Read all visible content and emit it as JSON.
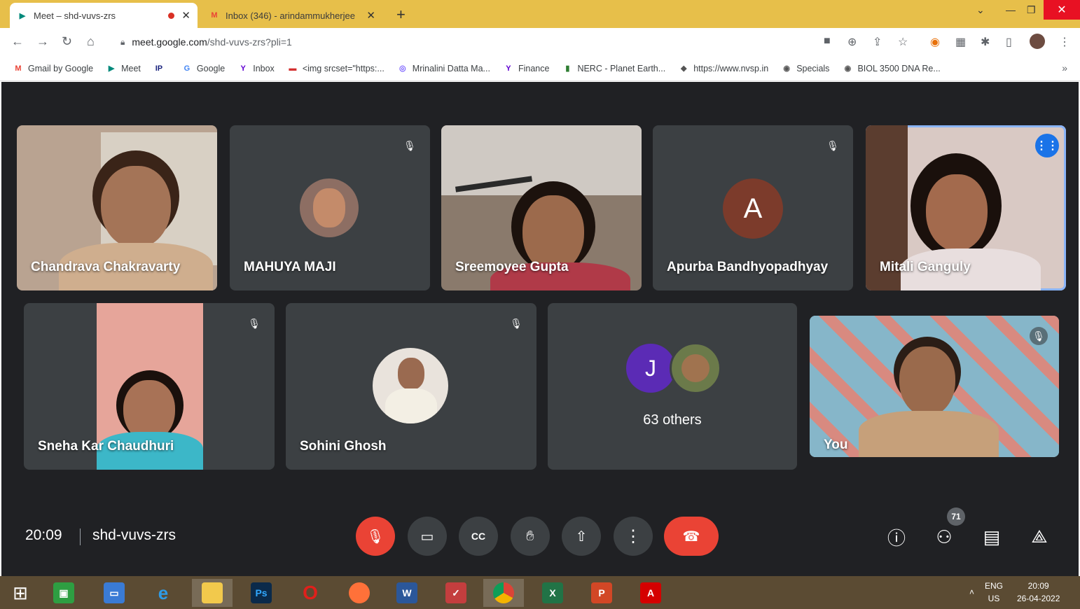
{
  "browser": {
    "tabs": [
      {
        "title": "Meet – shd-vuvs-zrs",
        "active": true,
        "recording": true
      },
      {
        "title": "Inbox (346) - arindammukherjee",
        "active": false
      }
    ],
    "new_tab_label": "+",
    "url_host": "meet.google.com",
    "url_path": "/shd-vuvs-zrs?pli=1",
    "bookmarks": [
      {
        "label": "Gmail by Google",
        "icon": "gmail-icon",
        "color": "#ea4335",
        "glyph": "M"
      },
      {
        "label": "Meet",
        "icon": "meet-icon",
        "color": "#00897b",
        "glyph": "▶"
      },
      {
        "label": "",
        "icon": "ip-icon",
        "color": "#1a237e",
        "glyph": "IP"
      },
      {
        "label": "Google",
        "icon": "google-icon",
        "color": "#4285f4",
        "glyph": "G"
      },
      {
        "label": "Inbox",
        "icon": "yahoo-icon",
        "color": "#6001d2",
        "glyph": "Y"
      },
      {
        "label": "<img srcset=\"https:...",
        "icon": "page-icon",
        "color": "#d32f2f",
        "glyph": "▬"
      },
      {
        "label": "Mrinalini Datta Ma...",
        "icon": "globe-icon",
        "color": "#7b61ff",
        "glyph": "◎"
      },
      {
        "label": "Finance",
        "icon": "yahoo-finance-icon",
        "color": "#6001d2",
        "glyph": "Y"
      },
      {
        "label": "NERC - Planet Earth...",
        "icon": "nerc-icon",
        "color": "#2e7d32",
        "glyph": "▮"
      },
      {
        "label": "https://www.nvsp.in",
        "icon": "nvsp-icon",
        "color": "#555555",
        "glyph": "◆"
      },
      {
        "label": "Specials",
        "icon": "globe-icon",
        "color": "#555555",
        "glyph": "◉"
      },
      {
        "label": "BIOL 3500 DNA Re...",
        "icon": "globe-icon",
        "color": "#555555",
        "glyph": "◉"
      }
    ],
    "bookmarks_more": "»"
  },
  "meet": {
    "participants": [
      {
        "name": "Chandrava Chakravarty",
        "muted": false
      },
      {
        "name": "MAHUYA MAJI",
        "muted": true
      },
      {
        "name": "Sreemoyee Gupta",
        "muted": false
      },
      {
        "name": "Apurba Bandhyopadhyay",
        "muted": true,
        "initial": "A",
        "avatar_color": "#7c3b2b"
      },
      {
        "name": "Mitali Ganguly",
        "muted": false,
        "speaking": true
      },
      {
        "name": "Sneha Kar Chaudhuri",
        "muted": true
      },
      {
        "name": "Sohini Ghosh",
        "muted": true
      },
      {
        "name": "63 others",
        "initial": "J",
        "avatar_color": "#5b2bb5"
      },
      {
        "name": "You",
        "muted": true
      }
    ],
    "time": "20:09",
    "meeting_code": "shd-vuvs-zrs",
    "participant_count": "71",
    "accent": "#1a73e8",
    "danger": "#ea4335"
  },
  "taskbar": {
    "lang_top": "ENG",
    "lang_bottom": "US",
    "time": "20:09",
    "date": "26-04-2022",
    "ps_label": "Ps"
  }
}
